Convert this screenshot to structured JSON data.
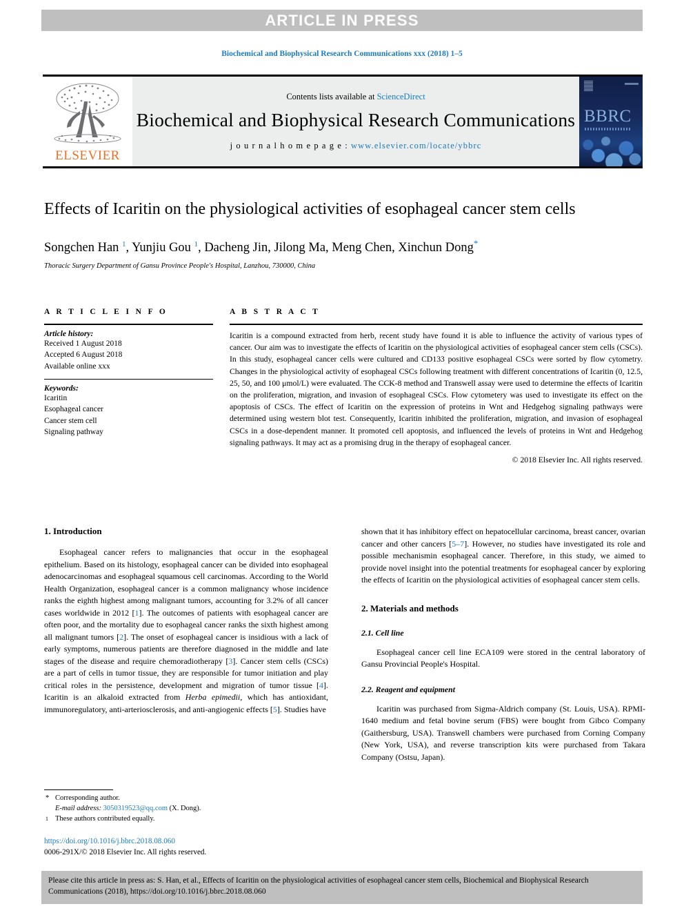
{
  "banner": {
    "label": "ARTICLE IN PRESS"
  },
  "running_head": "Biochemical and Biophysical Research Communications xxx (2018) 1–5",
  "masthead": {
    "contents_prefix": "Contents lists available at ",
    "sciencedirect": "ScienceDirect",
    "journal_title": "Biochemical and Biophysical Research Communications",
    "homepage_label": "j o u r n a l   h o m e p a g e :  ",
    "homepage_url": "www.elsevier.com/locate/ybbrc",
    "publisher_wordmark": "ELSEVIER",
    "cover_wordmark": "BBRC",
    "accent_color": "#1a7bbd",
    "publisher_color": "#ea7125"
  },
  "article": {
    "title": "Effects of Icaritin on the physiological activities of esophageal cancer stem cells",
    "authors_part1": "Songchen Han ",
    "authors_sup1": "1",
    "authors_part2": ", Yunjiu Gou ",
    "authors_sup2": "1",
    "authors_part3": ", Dacheng Jin, Jilong Ma, Meng Chen, Xinchun Dong",
    "authors_star": "*",
    "affiliation": "Thoracic Surgery Department of Gansu Province People's Hospital, Lanzhou, 730000, China"
  },
  "article_info": {
    "heading": "A R T I C L E   I N F O",
    "history_label": "Article history:",
    "history": [
      "Received 1 August 2018",
      "Accepted 6 August 2018",
      "Available online xxx"
    ],
    "keywords_label": "Keywords:",
    "keywords": [
      "Icaritin",
      "Esophageal cancer",
      "Cancer stem cell",
      "Signaling pathway"
    ]
  },
  "abstract": {
    "heading": "A B S T R A C T",
    "text": "Icaritin is a compound extracted from herb, recent study have found it is able to influence the activity of various types of cancer. Our aim was to investigate the effects of Icaritin on the physiological activities of esophageal cancer stem cells (CSCs). In this study, esophageal cancer cells were cultured and CD133 positive esophageal CSCs were sorted by flow cytometry. Changes in the physiological activity of esophageal CSCs following treatment with different concentrations of Icaritin (0, 12.5, 25, 50, and 100 μmol/L) were evaluated. The CCK-8 method and Transwell assay were used to determine the effects of Icaritin on the proliferation, migration, and invasion of esophageal CSCs. Flow cytometery was used to investigate its effect on the apoptosis of CSCs. The effect of Icaritin on the expression of proteins in Wnt and Hedgehog signaling pathways were determined using western blot test. Consequently, Icaritin inhibited the proliferation, migration, and invasion of esophageal CSCs in a dose-dependent manner. It promoted cell apoptosis, and influenced the levels of proteins in Wnt and Hedgehog signaling pathways. It may act as a promising drug in the therapy of esophageal cancer.",
    "copyright": "© 2018 Elsevier Inc. All rights reserved."
  },
  "body": {
    "left": {
      "intro_heading": "1.  Introduction",
      "p1_a": "Esophageal cancer refers to malignancies that occur in the esophageal epithelium. Based on its histology, esophageal cancer can be divided into esophageal adenocarcinomas and esophageal squamous cell carcinomas. According to the World Health Organization, esophageal cancer is a common malignancy whose incidence ranks the eighth highest among malignant tumors, accounting for 3.2% of all cancer cases worldwide in 2012 [",
      "r1": "1",
      "p1_b": "]. The outcomes of patients with esophageal cancer are often poor, and the mortality due to esophageal cancer ranks the sixth highest among all malignant tumors [",
      "r2": "2",
      "p1_c": "]. The onset of esophageal cancer is insidious with a lack of early symptoms, numerous patients are therefore diagnosed in the middle and late stages of the disease and require chemoradiotherapy [",
      "r3": "3",
      "p1_d": "]. Cancer stem cells (CSCs) are a part of cells in tumor tissue, they are responsible for tumor initiation and play critical roles in the persistence, development and migration of tumor tissue [",
      "r4": "4",
      "p1_e": "]. Icaritin is an alkaloid extracted from ",
      "p1_ital": "Herba epimedii",
      "p1_f": ", which has antioxidant, immunoregulatory, anti-arteriosclerosis, and anti-angiogenic effects [",
      "r5": "5",
      "p1_g": "]. Studies have"
    },
    "right": {
      "p1_a": "shown that it has inhibitory effect on hepatocellular carcinoma, breast cancer, ovarian cancer and other cancers [",
      "r57": "5–7",
      "p1_b": "]. However, no studies have investigated its role and possible mechanismin esophageal cancer. Therefore, in this study, we aimed to provide novel insight into the potential treatments for esophageal cancer by exploring the effects of Icaritin on the physiological activities of esophageal cancer stem cells.",
      "methods_heading": "2.  Materials and methods",
      "sub1_heading": "2.1.  Cell line",
      "sub1_text": "Esophageal cancer cell line ECA109 were stored in the central laboratory of Gansu Provincial People's Hospital.",
      "sub2_heading": "2.2.  Reagent and equipment",
      "sub2_text": "Icaritin was purchased from Sigma-Aldrich company (St. Louis, USA). RPMI-1640 medium and fetal bovine serum (FBS) were bought from Gibco Company (Gaithersburg, USA). Transwell chambers were purchased from Corning Company (New York, USA), and reverse transcription kits were purchased from Takara Company (Ostsu, Japan)."
    }
  },
  "footnotes": {
    "corresponding_mark": "*",
    "corresponding_text": "Corresponding author.",
    "email_label": "E-mail address:",
    "email": "3050319523@qq.com",
    "email_suffix": "(X. Dong).",
    "equal_mark": "1",
    "equal_text": "These authors contributed equally.",
    "doi_url": "https://doi.org/10.1016/j.bbrc.2018.08.060",
    "issn_line": "0006-291X/© 2018 Elsevier Inc. All rights reserved."
  },
  "citation_bar": {
    "text": "Please cite this article in press as: S. Han, et al., Effects of Icaritin on the physiological activities of esophageal cancer stem cells, Biochemical and Biophysical Research Communications (2018), https://doi.org/10.1016/j.bbrc.2018.08.060"
  }
}
